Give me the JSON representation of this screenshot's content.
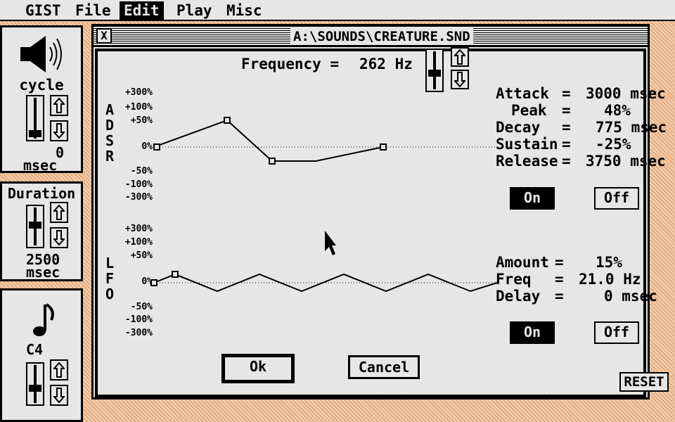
{
  "menubar": {
    "items": [
      "GIST",
      "File",
      "Edit",
      "Play",
      "Misc"
    ],
    "active": "Edit"
  },
  "window": {
    "title": "A:\\SOUNDS\\CREATURE.SND",
    "close_glyph": "X"
  },
  "left": {
    "cycle": {
      "label": "cycle",
      "value": "0",
      "unit": "msec"
    },
    "duration": {
      "label": "Duration",
      "value": "2500",
      "unit": "msec"
    },
    "note": {
      "label": "C4"
    }
  },
  "frequency": {
    "label": "Frequency =",
    "value": "262 Hz"
  },
  "adsr": {
    "side_letters": [
      "A",
      "D",
      "S",
      "R"
    ],
    "scale": [
      "+300%",
      "+100%",
      "+50%",
      "0%",
      "-50%",
      "-100%",
      "-300%"
    ],
    "params": [
      {
        "name": "Attack",
        "value": "3000 msec"
      },
      {
        "name": "Peak",
        "value": "48%"
      },
      {
        "name": "Decay",
        "value": "775 msec"
      },
      {
        "name": "Sustain",
        "value": "-25%"
      },
      {
        "name": "Release",
        "value": "3750 msec"
      }
    ],
    "on_label": "On",
    "off_label": "Off",
    "state": "On"
  },
  "lfo": {
    "side_letters": [
      "L",
      "F",
      "O"
    ],
    "scale": [
      "+300%",
      "+100%",
      "+50%",
      "0%",
      "-50%",
      "-100%",
      "-300%"
    ],
    "params": [
      {
        "name": "Amount",
        "value": "15%"
      },
      {
        "name": "Freq",
        "value": "21.0 Hz"
      },
      {
        "name": "Delay",
        "value": "0 msec"
      }
    ],
    "on_label": "On",
    "off_label": "Off",
    "state": "On"
  },
  "buttons": {
    "ok": "Ok",
    "cancel": "Cancel",
    "reset": "RESET"
  },
  "colors": {
    "desktop": "#f3c9a4",
    "panel": "#e6e6e6",
    "ink": "#000000"
  }
}
